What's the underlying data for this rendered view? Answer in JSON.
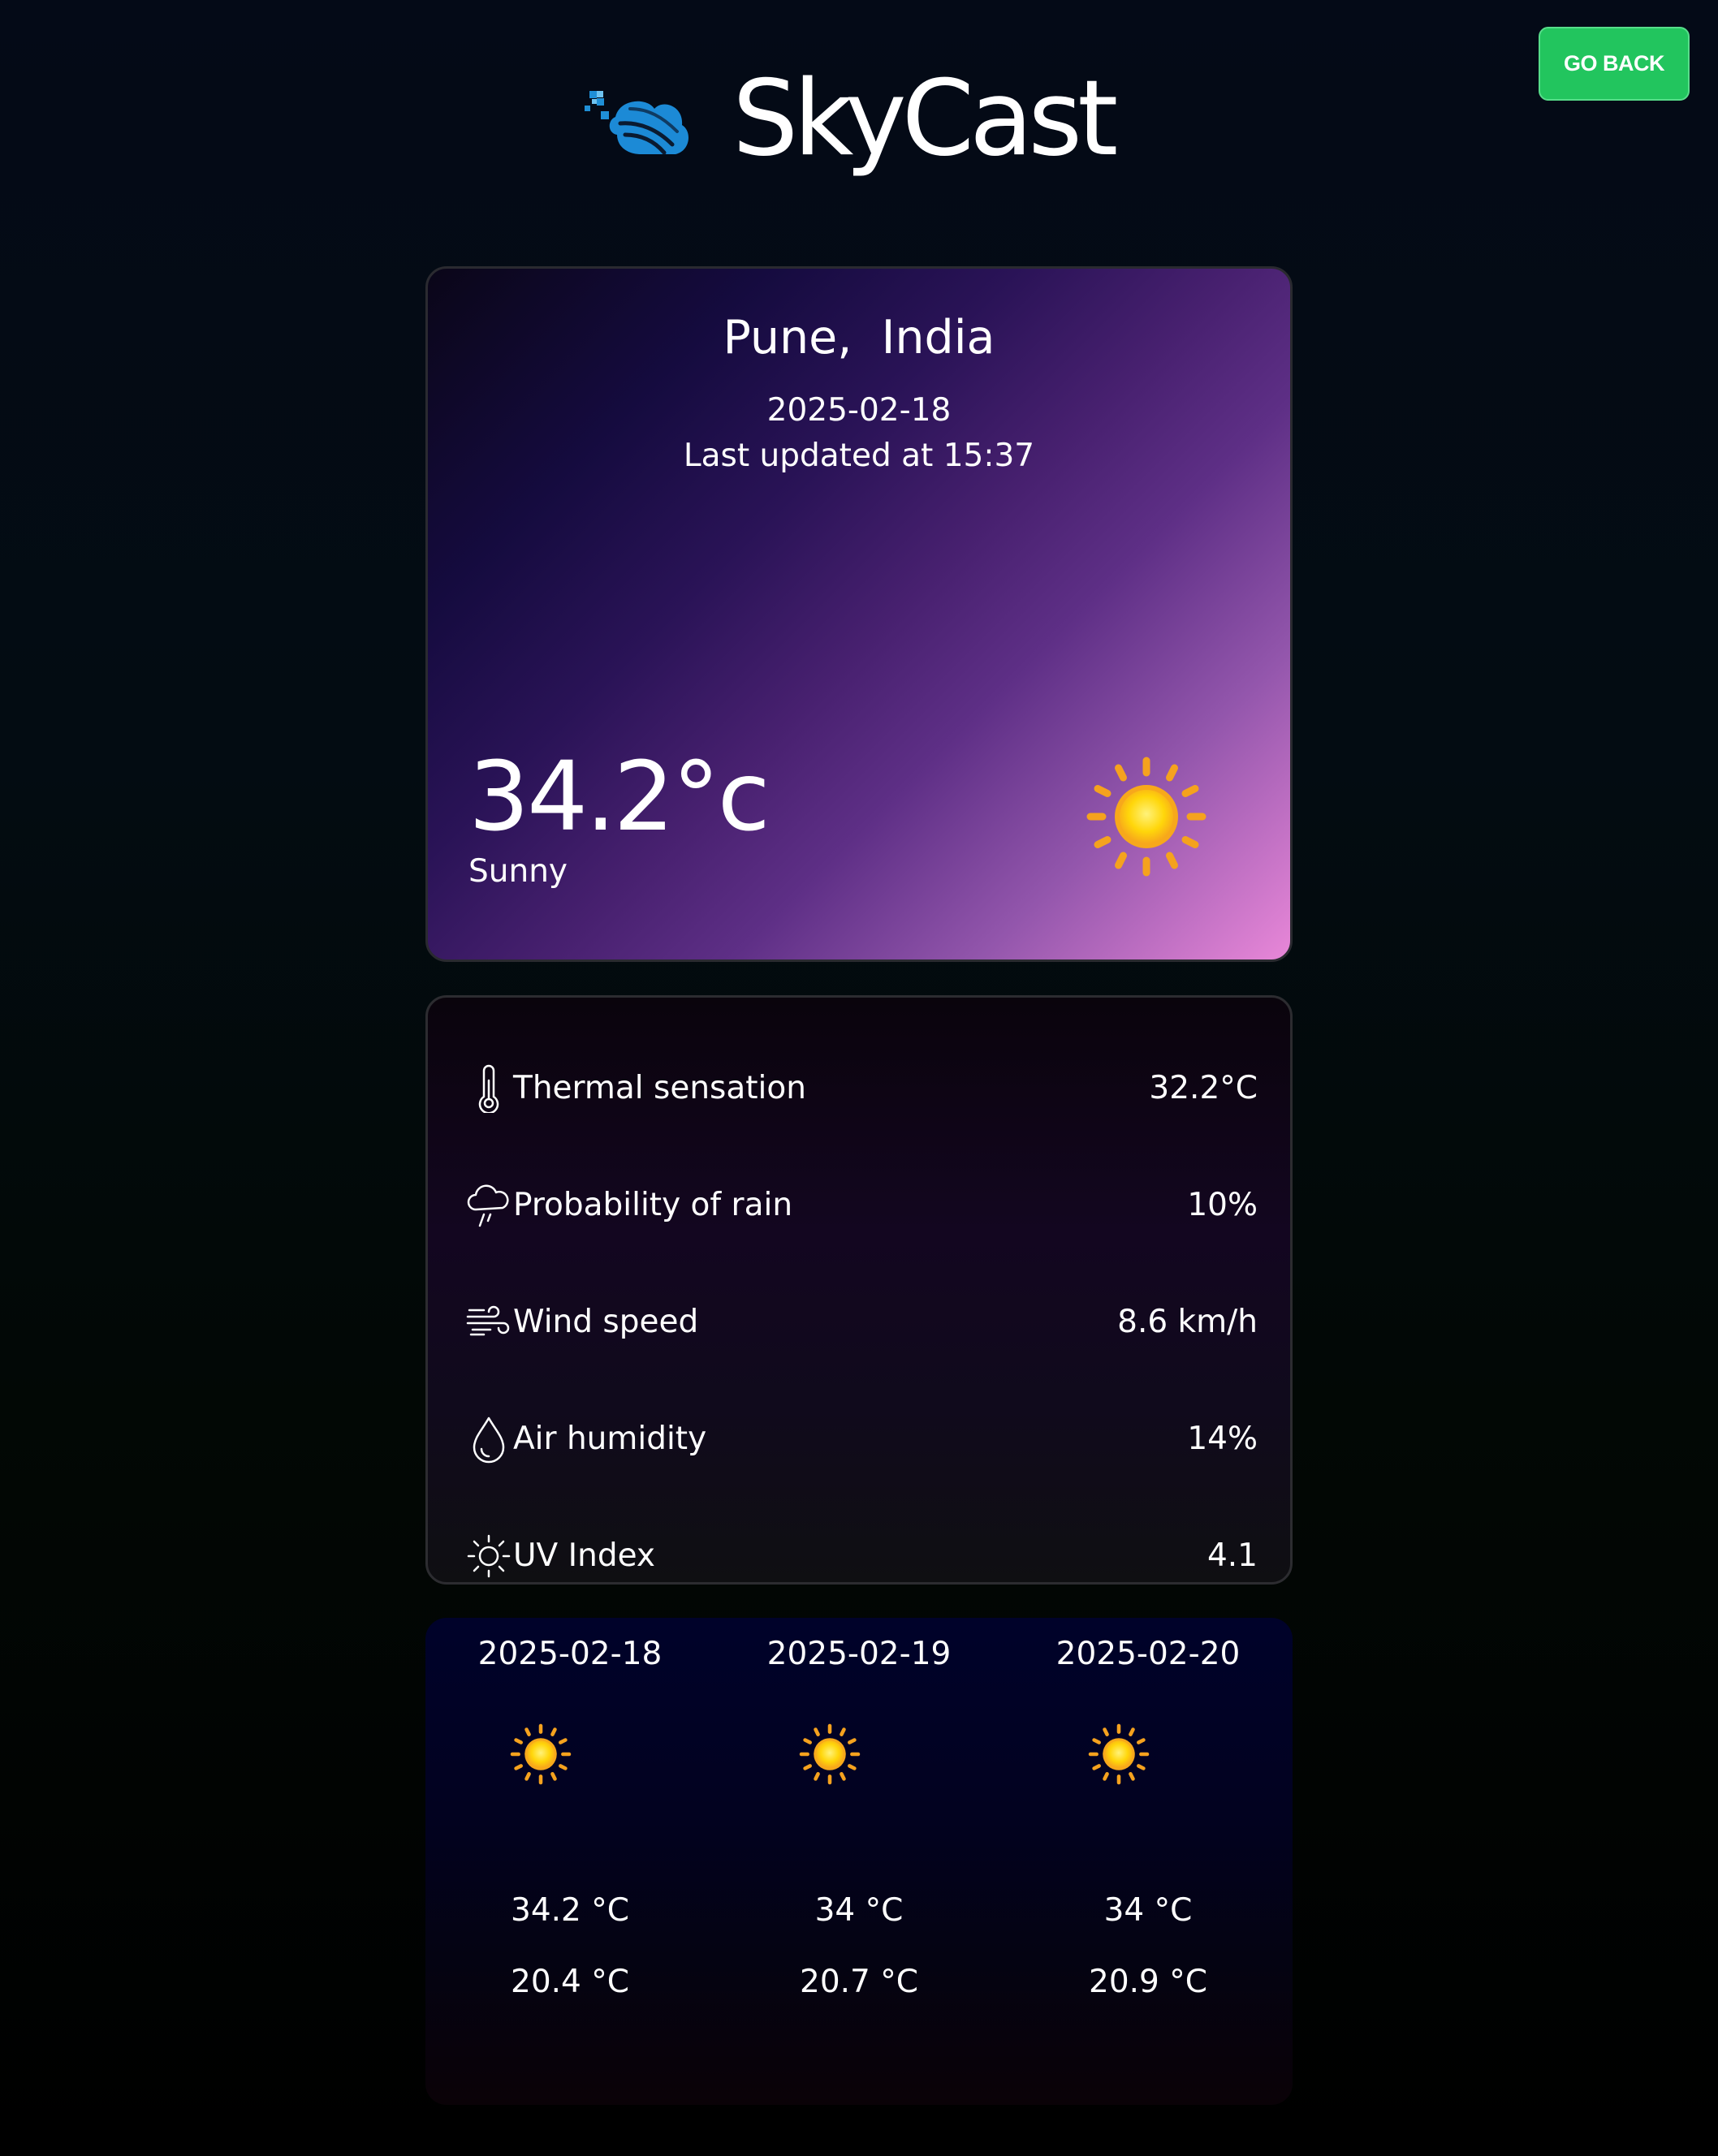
{
  "header": {
    "app_name": "SkyCast",
    "go_back_label": "GO BACK"
  },
  "current": {
    "city": "Pune,",
    "country": "India",
    "date": "2025-02-18",
    "last_updated": "Last updated at 15:37",
    "temperature": "34.2°c",
    "condition": "Sunny",
    "condition_icon": "sun-icon"
  },
  "details": [
    {
      "icon": "thermometer-icon",
      "label": "Thermal sensation",
      "value": "32.2°C"
    },
    {
      "icon": "rain-cloud-icon",
      "label": "Probability of rain",
      "value": "10%"
    },
    {
      "icon": "wind-icon",
      "label": "Wind speed",
      "value": "8.6 km/h"
    },
    {
      "icon": "droplet-icon",
      "label": "Air humidity",
      "value": "14%"
    },
    {
      "icon": "sun-outline-icon",
      "label": "UV Index",
      "value": "4.1"
    }
  ],
  "forecast": [
    {
      "date": "2025-02-18",
      "icon": "sun-icon",
      "max": "34.2 °C",
      "min": "20.4 °C"
    },
    {
      "date": "2025-02-19",
      "icon": "sun-icon",
      "max": "34 °C",
      "min": "20.7 °C"
    },
    {
      "date": "2025-02-20",
      "icon": "sun-icon",
      "max": "34 °C",
      "min": "20.9 °C"
    }
  ],
  "colors": {
    "go_back_bg": "#22c55e",
    "logo_blue": "#1f8fd6",
    "sun_core": "#ffd60a",
    "sun_rays": "#f5a623"
  }
}
